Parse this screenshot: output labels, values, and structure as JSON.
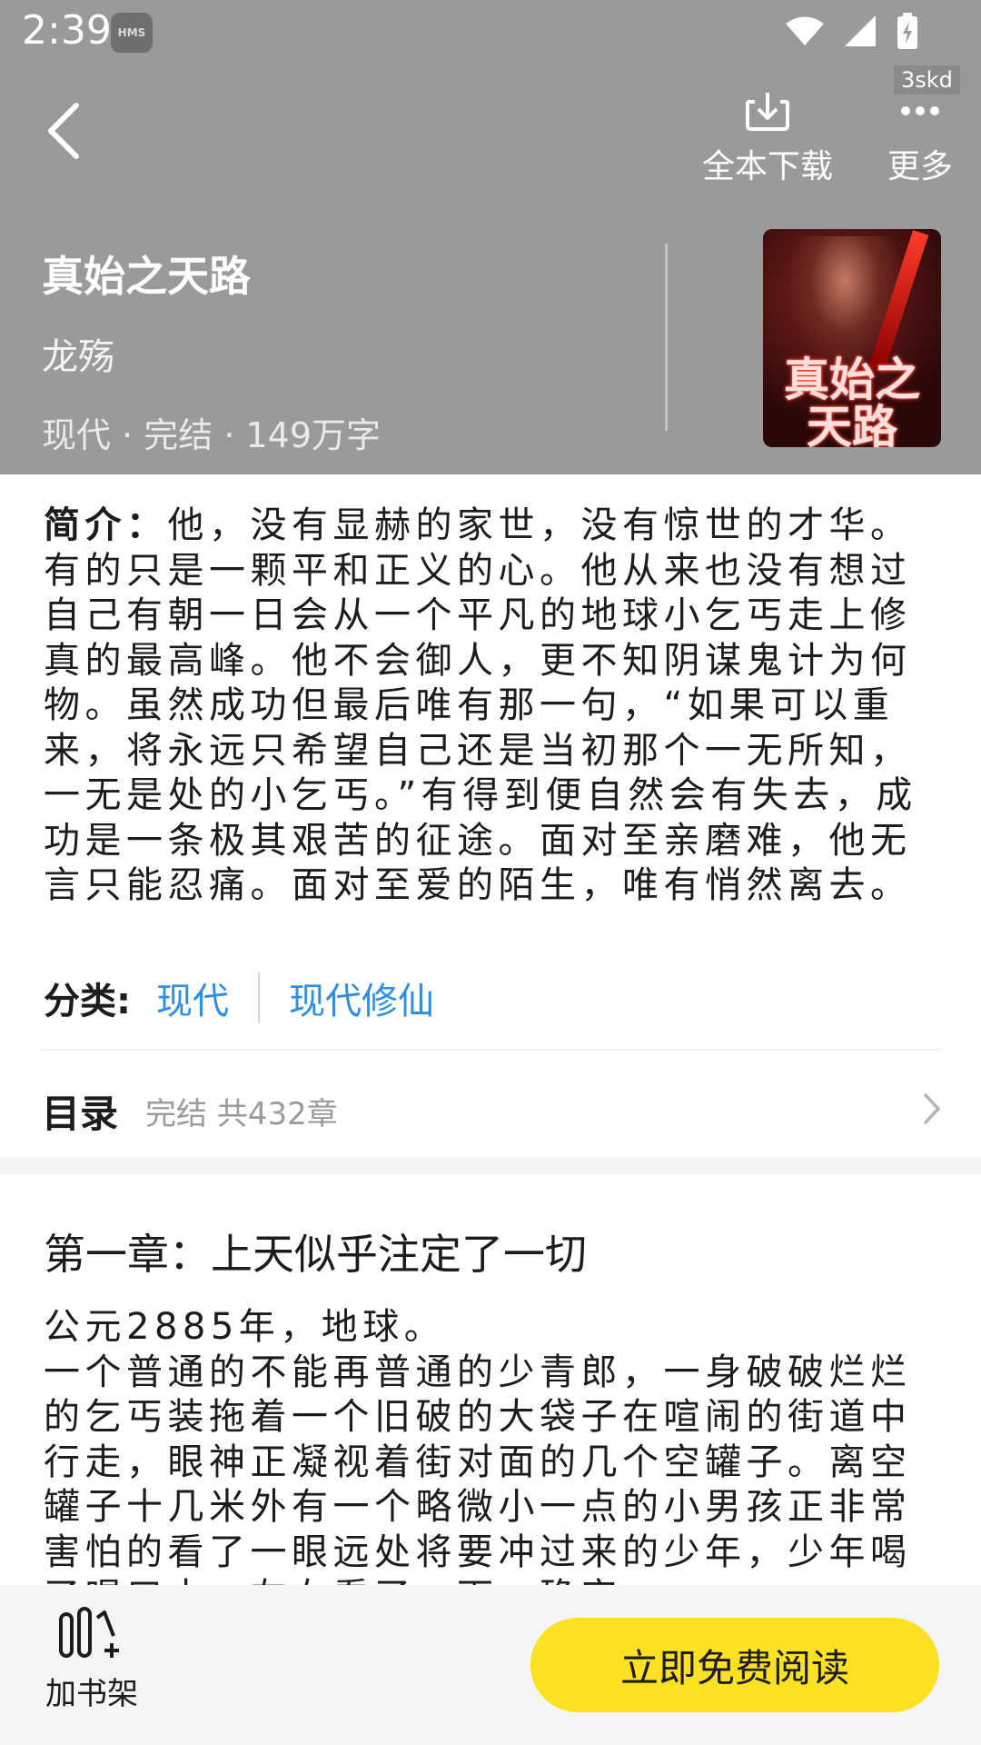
{
  "status_bar": {
    "time": "2:39",
    "hms_badge": "HMS"
  },
  "nav": {
    "download_label": "全本下载",
    "more_label": "更多",
    "more_badge": "3skd"
  },
  "book": {
    "title": "真始之天路",
    "author": "龙殇",
    "meta": "现代 · 完结 · 149万字",
    "cover_text": "真始之天路"
  },
  "synopsis": {
    "label": "简介：",
    "text": "他，没有显赫的家世，没有惊世的才华。有的只是一颗平和正义的心。他从来也没有想过自己有朝一日会从一个平凡的地球小乞丐走上修真的最高峰。他不会御人，更不知阴谋鬼计为何物。虽然成功但最后唯有那一句，“如果可以重来，将永远只希望自己还是当初那个一无所知，一无是处的小乞丐。”有得到便自然会有失去，成功是一条极其艰苦的征途。面对至亲磨难，他无言只能忍痛。面对至爱的陌生，唯有悄然离去。"
  },
  "category": {
    "label": "分类:",
    "tags": [
      "现代",
      "现代修仙"
    ]
  },
  "toc": {
    "label": "目录",
    "status": "完结  共432章"
  },
  "chapter": {
    "title": "第一章：上天似乎注定了一切",
    "paragraphs": [
      "公元2885年，地球。",
      "一个普通的不能再普通的少青郎，一身破破烂烂的乞丐装拖着一个旧破的大袋子在喧闹的街道中行走，眼神正凝视着街对面的几个空罐子。离空罐子十几米外有一个略微小一点的小男孩正非常害怕的看了一眼远处将要冲过来的少年，少年喝了喝口水，左右看了一下，确定"
    ]
  },
  "bottom_bar": {
    "shelf_label": "加书架",
    "read_button": "立即免费阅读"
  },
  "colors": {
    "header_bg": "#9a9a9a",
    "tag_blue": "#2e8ee0",
    "read_button_yellow": "#fde122"
  }
}
